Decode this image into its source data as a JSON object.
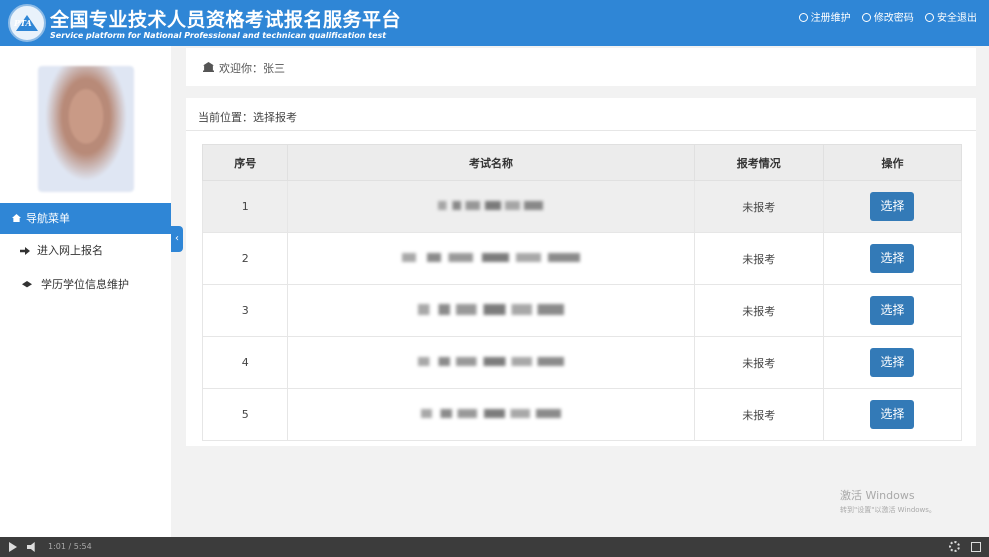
{
  "header": {
    "logo_text": "PTA",
    "title_cn": "全国专业技术人员资格考试报名服务平台",
    "title_en": "Service platform for National Professional and technican qualification test",
    "links": [
      "注册维护",
      "修改密码",
      "安全退出"
    ]
  },
  "sidebar": {
    "menu_title": "导航菜单",
    "items": [
      "进入网上报名",
      "学历学位信息维护"
    ]
  },
  "welcome": {
    "text": "欢迎你：张三"
  },
  "breadcrumb": "当前位置：选择报考",
  "table": {
    "headers": [
      "序号",
      "考试名称",
      "报考情况",
      "操作"
    ],
    "rows": [
      {
        "no": "1",
        "status": "未报考",
        "action": "选择"
      },
      {
        "no": "2",
        "status": "未报考",
        "action": "选择"
      },
      {
        "no": "3",
        "status": "未报考",
        "action": "选择"
      },
      {
        "no": "4",
        "status": "未报考",
        "action": "选择"
      },
      {
        "no": "5",
        "status": "未报考",
        "action": "选择"
      }
    ]
  },
  "watermark": {
    "line1": "激活 Windows",
    "line2": "转到\"设置\"以激活 Windows。"
  },
  "player": {
    "time": "1:01 / 5:54"
  },
  "colors": {
    "brand_blue": "#2f86d6",
    "button_blue": "#337ab7"
  }
}
